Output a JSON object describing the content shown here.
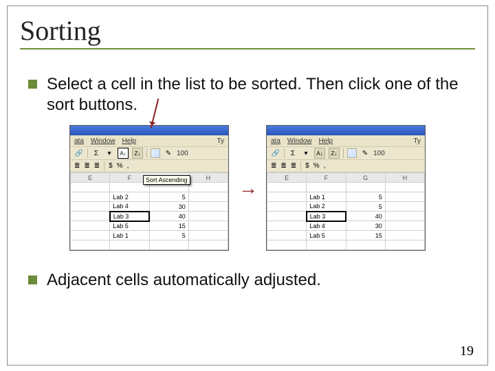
{
  "title": "Sorting",
  "bullets": {
    "b1": "Select a cell in the list to be sorted.  Then click one of the sort buttons.",
    "b2": "Adjacent cells automatically adjusted."
  },
  "menu": {
    "m1": "ata",
    "m2": "Window",
    "m3": "Help",
    "tail": "Ty"
  },
  "tb": {
    "sigma": "Σ",
    "sortA": "A↓",
    "sortZ": "Z↓",
    "pct": "100"
  },
  "tb2": {
    "a": "≣",
    "b": "≣",
    "c": "≣",
    "d": "$",
    "e": "%",
    "f": ","
  },
  "tooltip": "Sort Ascending",
  "cols": {
    "E": "E",
    "F": "F",
    "G": "G",
    "H": "H"
  },
  "left_rows": [
    {
      "f": "Lab 2",
      "g": "5"
    },
    {
      "f": "Lab 4",
      "g": "30"
    },
    {
      "f": "Lab 3",
      "g": "40"
    },
    {
      "f": "Lab 5",
      "g": "15"
    },
    {
      "f": "Lab 1",
      "g": "5"
    }
  ],
  "right_rows": [
    {
      "f": "Lab 1",
      "g": "5"
    },
    {
      "f": "Lab 2",
      "g": "5"
    },
    {
      "f": "Lab 3",
      "g": "40"
    },
    {
      "f": "Lab 4",
      "g": "30"
    },
    {
      "f": "Lab 5",
      "g": "15"
    }
  ],
  "left_selected": 2,
  "right_selected": 2,
  "page": "19"
}
